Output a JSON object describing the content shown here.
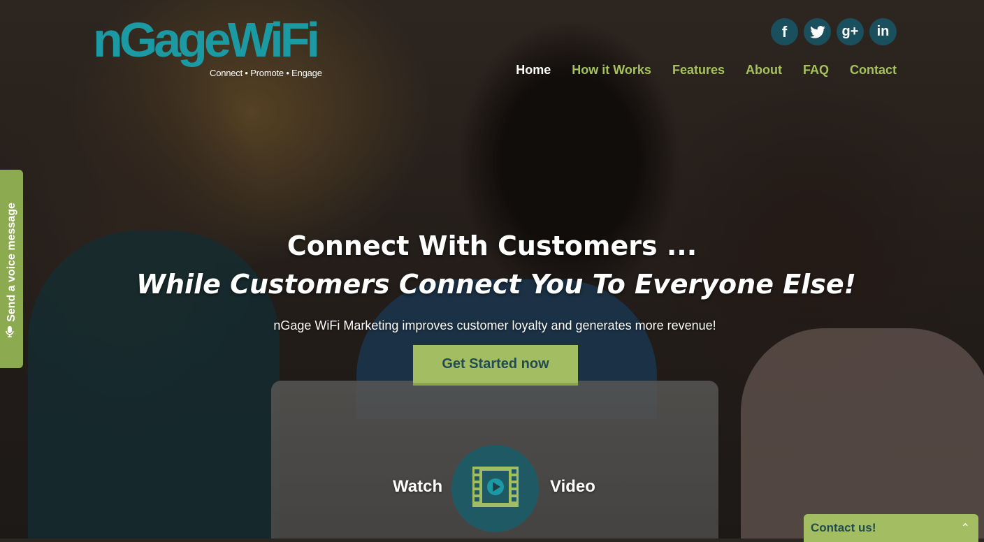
{
  "brand": {
    "name": "nGageWiFi",
    "tagline": "Connect • Promote • Engage",
    "color": "#1b9aa4"
  },
  "social": [
    {
      "icon": "facebook-icon",
      "glyph": "f"
    },
    {
      "icon": "twitter-icon",
      "glyph": "🐦"
    },
    {
      "icon": "google-plus-icon",
      "glyph": "g+"
    },
    {
      "icon": "linkedin-icon",
      "glyph": "in"
    }
  ],
  "nav": {
    "items": [
      {
        "label": "Home",
        "active": true
      },
      {
        "label": "How it Works",
        "active": false
      },
      {
        "label": "Features",
        "active": false
      },
      {
        "label": "About",
        "active": false
      },
      {
        "label": "FAQ",
        "active": false
      },
      {
        "label": "Contact",
        "active": false
      }
    ]
  },
  "voice_tab": {
    "label": "Send a voice message",
    "icon": "microphone-icon"
  },
  "hero": {
    "headline": "Connect With Customers ...",
    "subheadline": "While Customers Connect You To Everyone Else!",
    "tagline": "nGage WiFi Marketing improves customer loyalty and generates more revenue!",
    "cta_label": "Get Started now",
    "watch_label": "Watch",
    "video_label": "Video",
    "video_icon": "film-play-icon"
  },
  "contact_bar": {
    "label": "Contact us!",
    "icon": "chevron-up-icon"
  },
  "colors": {
    "accent_green": "#a3be62",
    "dark_teal": "#1f5a64",
    "nav_green": "#a6c260"
  }
}
